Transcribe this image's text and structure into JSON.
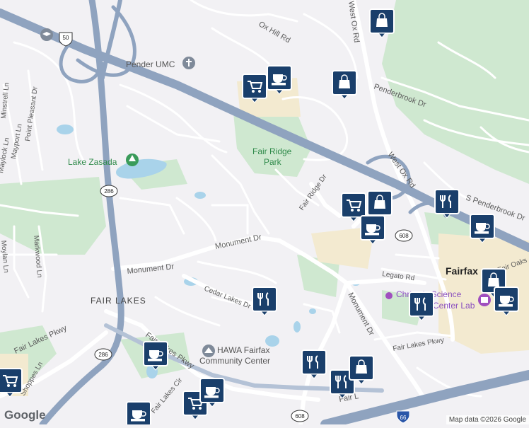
{
  "labels": {
    "ox_hill_rd": "Ox Hill Rd",
    "west_ox_rd_north": "West Ox Rd",
    "penderbrook_dr": "Penderbrook Dr",
    "pender_umc": "Pender UMC",
    "minstrell_ln": "Minstrell Ln",
    "point_pleasant_dr": "Point Pleasant Dr",
    "mayport_ln": "Mayport Ln",
    "maylock_ln": "Maylock Ln",
    "lake_zasada": "Lake Zasada",
    "fair_ridge_park_1": "Fair Ridge",
    "fair_ridge_park_2": "Park",
    "fair_ridge_dr": "Fair Ridge Dr",
    "west_ox_rd": "West Ox Rd",
    "s_penderbrook_dr": "S Penderbrook Dr",
    "monument_dr_mid": "Monument Dr",
    "monument_dr_west": "Monument Dr",
    "monument_dr_south": "Monument Dr",
    "markwood_ln": "Markwood Ln",
    "moylan_ln": "Moylan Ln",
    "fair_lakes": "FAIR LAKES",
    "cedar_lakes_dr": "Cedar Lakes Dr",
    "legato_rd": "Legato Rd",
    "fair_lakes_city": "Fairfax",
    "fair_oaks": "Fair Oaks",
    "chantilly_science_1": "Christa's Science",
    "chantilly_science_2": "Center Lab",
    "fair_lakes_pkwy_east": "Fair Lakes Pkwy",
    "fair_lakes_pkwy_west": "Fair Lakes Pkwy",
    "fair_lakes_pkwy_sw": "Fair Lakes Pkwy",
    "shoppes_ln": "Shoppes Ln",
    "fair_lakes_cir": "Fair Lakes Cir",
    "hawa_1": "HAWA Fairfax",
    "hawa_2": "Community Center",
    "fair_lakes_bottom": "Fair L"
  },
  "shields": {
    "us50": "50",
    "sr286_north": "286",
    "sr286_south": "286",
    "sr608_east": "608",
    "sr608_south": "608",
    "i66": "66"
  },
  "markers": [
    {
      "icon": "shopping-bag-icon"
    },
    {
      "icon": "shopping-cart-icon"
    },
    {
      "icon": "coffee-cup-icon"
    },
    {
      "icon": "shopping-bag-icon"
    },
    {
      "icon": "shopping-cart-icon"
    },
    {
      "icon": "shopping-bag-icon"
    },
    {
      "icon": "coffee-cup-icon"
    },
    {
      "icon": "restaurant-icon"
    },
    {
      "icon": "coffee-cup-icon"
    },
    {
      "icon": "shopping-bag-icon"
    },
    {
      "icon": "coffee-cup-icon"
    },
    {
      "icon": "restaurant-icon"
    },
    {
      "icon": "restaurant-icon"
    },
    {
      "icon": "coffee-cup-icon"
    },
    {
      "icon": "shopping-cart-icon"
    },
    {
      "icon": "restaurant-icon"
    },
    {
      "icon": "restaurant-icon"
    },
    {
      "icon": "shopping-bag-icon"
    },
    {
      "icon": "shopping-cart-icon"
    },
    {
      "icon": "coffee-cup-icon"
    },
    {
      "icon": "coffee-cup-icon"
    }
  ],
  "google_logo": "Google",
  "attribution": "Map data ©2026 Google",
  "colors": {
    "land": "#f2f1f4",
    "park": "#c8e6c9",
    "water": "#a7d1e8",
    "highway": "#8fa3bf",
    "commercial": "#f4ecd2",
    "marker": "#1a3f6b"
  }
}
